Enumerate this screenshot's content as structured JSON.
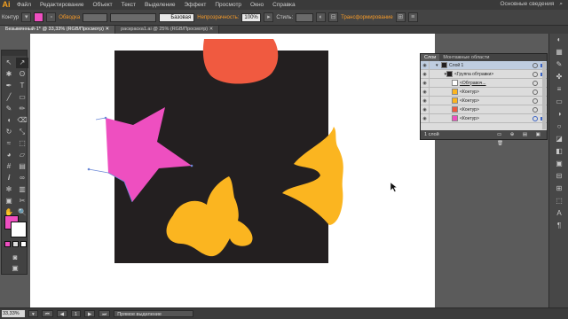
{
  "app": {
    "logo": "Ai"
  },
  "menu": [
    "Файл",
    "Редактирование",
    "Объект",
    "Текст",
    "Выделение",
    "Эффект",
    "Просмотр",
    "Окно",
    "Справка"
  ],
  "workspace": {
    "label": "Основные сведения",
    "search_icon": "search-icon"
  },
  "control_bar": {
    "object_label": "Контур",
    "fill_color": "#ee4fc0",
    "stroke_label": "Обводка",
    "brush_label": "Базовая",
    "opacity_label": "Непрозрачность:",
    "opacity_value": "100%",
    "style_label": "Стиль:",
    "transform_label": "Трансформирование"
  },
  "tabs": [
    {
      "label": "Безымянный-1* @ 33,33% (RGB/Просмотр)",
      "close": "✕"
    },
    {
      "label": "раскраска1.ai @ 25% (RGB/Просмотр)",
      "close": "✕"
    }
  ],
  "toolbox": {
    "fill_color": "#ee4fc0",
    "stroke_color": "#ffffff",
    "tools": [
      "selection-icon",
      "direct-selection-icon",
      "magic-wand-icon",
      "lasso-icon",
      "pen-icon",
      "type-icon",
      "line-icon",
      "rectangle-icon",
      "paintbrush-icon",
      "pencil-icon",
      "blob-brush-icon",
      "eraser-icon",
      "rotate-icon",
      "scale-icon",
      "warp-icon",
      "free-transform-icon",
      "shape-builder-icon",
      "perspective-icon",
      "mesh-icon",
      "gradient-icon",
      "eyedropper-icon",
      "blend-icon",
      "symbol-sprayer-icon",
      "column-graph-icon",
      "artboard-icon",
      "slice-icon",
      "hand-icon",
      "zoom-icon"
    ],
    "tool_glyphs": [
      "↖",
      "↗",
      "✱",
      "ʘ",
      "✒",
      "T",
      "╱",
      "▭",
      "✎",
      "✏",
      "◖",
      "⌫",
      "↻",
      "⤡",
      "≈",
      "⬚",
      "◕",
      "▱",
      "#",
      "▤",
      "𝒊",
      "∞",
      "✻",
      "▥",
      "▣",
      "✂",
      "✋",
      "🔍"
    ]
  },
  "canvas": {
    "background": "#231f20",
    "shapes": {
      "circle": "#f05a40",
      "star": "#ee4fc0",
      "yellow": "#fbb520"
    }
  },
  "layers_panel": {
    "tabs": [
      "Слои",
      "Монтажные области"
    ],
    "rows": [
      {
        "name": "Слой 1",
        "thumb": "#231f20"
      },
      {
        "name": "<Группа обтравки>",
        "thumb": "#231f20"
      },
      {
        "name": "<Обтравоч...",
        "thumb": "#ffffff"
      },
      {
        "name": "<Контур>",
        "thumb": "#fbb520"
      },
      {
        "name": "<Контур>",
        "thumb": "#fbb520"
      },
      {
        "name": "<Контур>",
        "thumb": "#f05a40"
      },
      {
        "name": "<Контур>",
        "thumb": "#ee4fc0"
      }
    ],
    "footer": "1 слой"
  },
  "status": {
    "zoom": "33,33%",
    "page": "1",
    "tool": "Прямое выделение"
  }
}
